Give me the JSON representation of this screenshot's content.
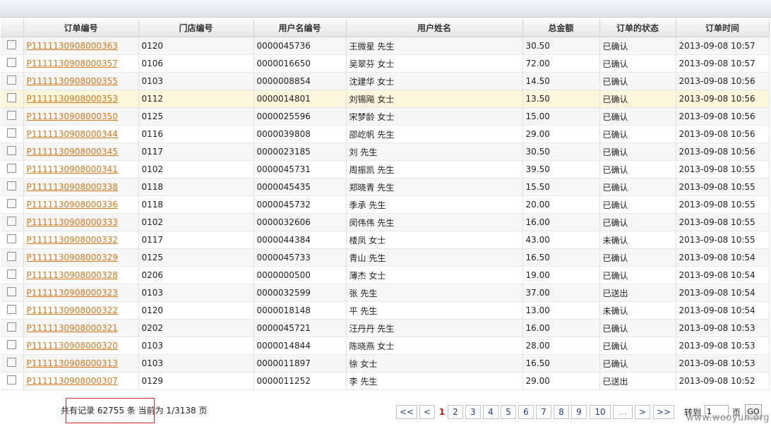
{
  "columns": [
    "",
    "订单编号",
    "门店编号",
    "用户名编号",
    "用户姓名",
    "总金额",
    "订单的状态",
    "订单时间"
  ],
  "rows": [
    [
      "P1111130908000363",
      "0120",
      "0000045736",
      "王微星 先生",
      "30.50",
      "已确认",
      "2013-09-08 10:57"
    ],
    [
      "P1111130908000357",
      "0106",
      "0000016650",
      "吴翠芬 女士",
      "72.00",
      "已确认",
      "2013-09-08 10:57"
    ],
    [
      "P1111130908000355",
      "0103",
      "0000008854",
      "沈建华 女士",
      "14.50",
      "已确认",
      "2013-09-08 10:56"
    ],
    [
      "P1111130908000353",
      "0112",
      "0000014801",
      "刘锡飚 女士",
      "13.50",
      "已确认",
      "2013-09-08 10:56"
    ],
    [
      "P1111130908000350",
      "0125",
      "0000025596",
      "宋梦龄 女士",
      "15.00",
      "已确认",
      "2013-09-08 10:56"
    ],
    [
      "P1111130908000344",
      "0116",
      "0000039808",
      "邵屹帆 先生",
      "29.00",
      "已确认",
      "2013-09-08 10:56"
    ],
    [
      "P1111130908000345",
      "0117",
      "0000023185",
      "刘 先生",
      "30.50",
      "已确认",
      "2013-09-08 10:56"
    ],
    [
      "P1111130908000341",
      "0102",
      "0000045731",
      "周振凯 先生",
      "39.50",
      "已确认",
      "2013-09-08 10:55"
    ],
    [
      "P1111130908000338",
      "0118",
      "0000045435",
      "郑晓青 先生",
      "15.50",
      "已确认",
      "2013-09-08 10:55"
    ],
    [
      "P1111130908000336",
      "0118",
      "0000045732",
      "季承 先生",
      "20.00",
      "已确认",
      "2013-09-08 10:55"
    ],
    [
      "P1111130908000333",
      "0102",
      "0000032606",
      "闵伟伟 先生",
      "16.00",
      "已确认",
      "2013-09-08 10:55"
    ],
    [
      "P1111130908000332",
      "0117",
      "0000044384",
      "楼凤 女士",
      "43.00",
      "未确认",
      "2013-09-08 10:55"
    ],
    [
      "P1111130908000329",
      "0125",
      "0000045733",
      "青山 先生",
      "16.50",
      "已确认",
      "2013-09-08 10:54"
    ],
    [
      "P1111130908000328",
      "0206",
      "0000000500",
      "薄杰 女士",
      "19.00",
      "已确认",
      "2013-09-08 10:54"
    ],
    [
      "P1111130908000323",
      "0103",
      "0000032599",
      "张 先生",
      "37.00",
      "已送出",
      "2013-09-08 10:54"
    ],
    [
      "P1111130908000322",
      "0120",
      "0000018148",
      "平 先生",
      "13.00",
      "未确认",
      "2013-09-08 10:54"
    ],
    [
      "P1111130908000321",
      "0202",
      "0000045721",
      "汪丹丹 先生",
      "16.00",
      "已确认",
      "2013-09-08 10:53"
    ],
    [
      "P1111130908000320",
      "0103",
      "0000014844",
      "陈晓燕 女士",
      "28.00",
      "已确认",
      "2013-09-08 10:53"
    ],
    [
      "P1111130908000313",
      "0103",
      "0000011897",
      "徐 女士",
      "16.50",
      "已确认",
      "2013-09-08 10:53"
    ],
    [
      "P1111130908000307",
      "0129",
      "0000011252",
      "李 先生",
      "29.00",
      "已送出",
      "2013-09-08 10:52"
    ]
  ],
  "highlighted_row": 3,
  "footer": {
    "summary": "共有记录 62755 条 当前为 1/3138 页"
  },
  "pager": {
    "first": "<<",
    "prev": "<",
    "pages": [
      "1",
      "2",
      "3",
      "4",
      "5",
      "6",
      "7",
      "8",
      "9",
      "10"
    ],
    "current": "1",
    "ellipsis": "...",
    "next": ">",
    "last": ">>",
    "jump_label": "转到",
    "jump_value": "1",
    "page_unit": "页",
    "go": "GO"
  },
  "watermark": "www.wooyun.org",
  "colors": {
    "link": "#d5771b",
    "highlight_row": "#fcf6dd",
    "current_page": "#cc1111",
    "annotation_box": "#cf2a2a"
  }
}
